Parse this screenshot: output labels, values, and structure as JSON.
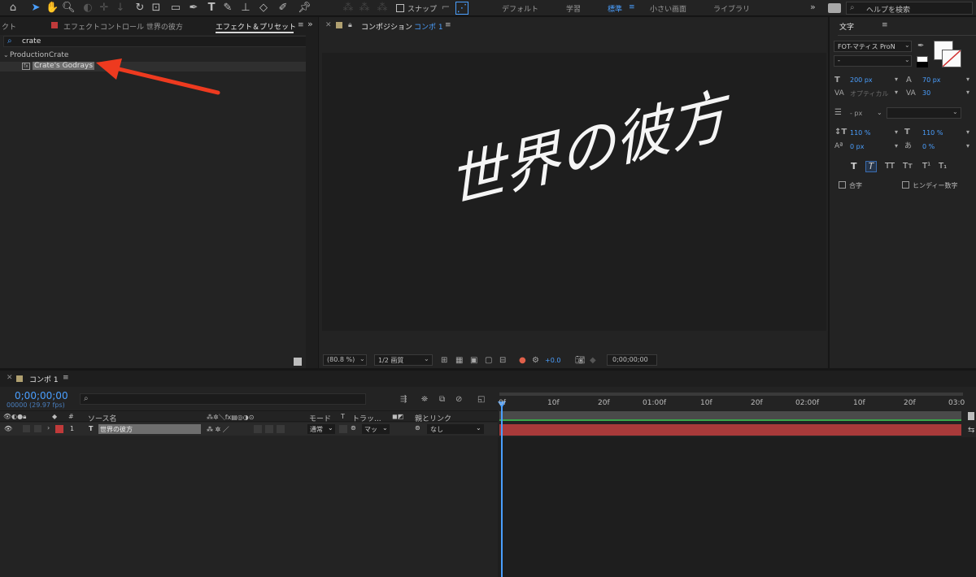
{
  "toolbar": {
    "snap_label": "スナップ",
    "workspaces": [
      "デフォルト",
      "学習",
      "標準",
      "小さい画面",
      "ライブラリ"
    ],
    "active_workspace": "標準",
    "search_help_placeholder": "ヘルプを検索"
  },
  "left_panel": {
    "tab_project_fragment": "クト",
    "tab_effect_controls": "エフェクトコントロール 世界の彼方",
    "tab_effects_presets": "エフェクト＆プリセット",
    "search_value": "crate",
    "folder_name": "ProductionCrate",
    "effect_item": "Crate's Godrays"
  },
  "composition": {
    "tab_label": "コンポジション",
    "comp_name": "コンポ 1",
    "canvas_text": "世界の彼方",
    "zoom": "(80.8 %)",
    "resolution": "1/2 画質",
    "exposure": "+0.0",
    "timecode": "0;00;00;00"
  },
  "character_panel": {
    "title": "文字",
    "font_name": "FOT-マティス ProN",
    "font_style": "-",
    "font_size": "200 px",
    "leading": "70 px",
    "kerning": "オプティカル",
    "tracking": "30",
    "stroke_width": "- px",
    "vertical_scale": "110 %",
    "horizontal_scale": "110 %",
    "baseline_shift": "0 px",
    "tsume": "0 %",
    "ligature_label": "合字",
    "hindi_label": "ヒンディー数字"
  },
  "timeline": {
    "tab_label": "コンポ 1",
    "current_time": "0;00;00;00",
    "frame_info": "00000 (29.97 fps)",
    "columns": {
      "number": "#",
      "source_name": "ソース名",
      "mode": "モード",
      "t": "T",
      "track_matte": "トラッ...",
      "parent": "親とリンク"
    },
    "ruler_labels": [
      "0f",
      "10f",
      "20f",
      "01:00f",
      "10f",
      "20f",
      "02:00f",
      "10f",
      "20f",
      "03:0"
    ],
    "layer": {
      "index": "1",
      "name": "世界の彼方",
      "mode": "通常",
      "matte": "マッ",
      "parent": "なし"
    }
  }
}
